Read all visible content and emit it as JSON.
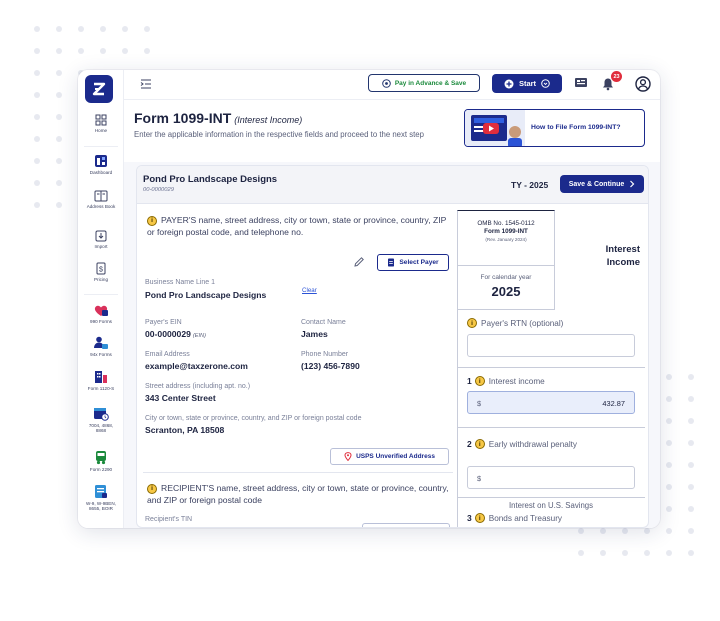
{
  "colors": {
    "brand": "#1b2a8c",
    "pay_text": "#1b8a3c",
    "notification": "#e02d3c",
    "info_icon": "#f7c846",
    "link": "#2b53d6",
    "filled_input": "#e9eefb"
  },
  "sidebar": {
    "logo": "taxzerone-logo",
    "items": [
      {
        "label": "Home",
        "icon": "home-grid-icon"
      },
      {
        "label": "Dashboard",
        "icon": "dashboard-icon"
      },
      {
        "label": "Address Book",
        "icon": "address-book-icon"
      },
      {
        "label": "Import",
        "icon": "import-icon"
      },
      {
        "label": "Pricing",
        "icon": "pricing-icon"
      },
      {
        "label": "990 Forms",
        "icon": "990-forms-icon"
      },
      {
        "label": "94x Forms",
        "icon": "94x-forms-icon"
      },
      {
        "label": "Form 1120-S",
        "icon": "form-1120s-icon"
      },
      {
        "label": "7004, 4868, 8868",
        "icon": "extension-forms-icon"
      },
      {
        "label": "Form 2290",
        "icon": "form-2290-icon"
      },
      {
        "label": "W-9, W-9BEN, 8655, BOIR",
        "icon": "w9-forms-icon"
      }
    ]
  },
  "topbar": {
    "menu_icon": "collapse-menu-icon",
    "pay_in_advance_label": "Pay in Advance & Save",
    "start_label": "Start",
    "notification_count": "23"
  },
  "header": {
    "title": "Form 1099-INT",
    "subtitle": "(Interest Income)",
    "description": "Enter the applicable information in the respective fields and proceed to the next step",
    "video_link_label": "How to File Form 1099-INT?"
  },
  "form": {
    "payer_name": "Pond Pro Landscape Designs",
    "payer_ein_short": "00-0000029",
    "tax_year_label": "TY - 2025",
    "save_continue_label": "Save & Continue",
    "payer_section_label": "PAYER'S name, street address, city or town, state or province, country, ZIP or foreign postal code, and telephone no.",
    "select_payer_label": "Select Payer",
    "business_name_label": "Business Name Line 1",
    "business_name_value": "Pond Pro Landscape Designs",
    "clear_label": "Clear",
    "payer_ein_label": "Payer's EIN",
    "payer_ein_value": "00-0000029",
    "ein_tag": "(EIN)",
    "contact_name_label": "Contact Name",
    "contact_name_value": "James",
    "email_label": "Email Address",
    "email_value": "example@taxzerone.com",
    "phone_label": "Phone Number",
    "phone_value": "(123) 456-7890",
    "street_label": "Street address (including apt. no.)",
    "street_value": "343 Center Street",
    "city_label": "City or town, state or province, country, and ZIP or foreign postal code",
    "city_value": "Scranton, PA 18508",
    "usps_label": "USPS Unverified Address",
    "recipient_section_label": "RECIPIENT'S name, street address, city or town, state or province, country, and ZIP or foreign postal code",
    "recipient_tin_label": "Recipient's TIN"
  },
  "right_panel": {
    "omb_line": "OMB No. 1545-0112",
    "omb_form": "Form 1099-INT",
    "omb_rev": "(Rev. January 2024)",
    "calendar_label": "For calendar year",
    "calendar_year": "2025",
    "interest_income_title": "Interest Income",
    "payer_rtn_label": "Payer's RTN (optional)",
    "box1_num": "1",
    "box1_label": "Interest income",
    "box1_currency": "$",
    "box1_value": "432.87",
    "box2_num": "2",
    "box2_label": "Early withdrawal penalty",
    "box2_currency": "$",
    "box3_num": "3",
    "box3_label_line1": "Interest on U.S. Savings",
    "box3_label_line2": "Bonds and Treasury"
  }
}
